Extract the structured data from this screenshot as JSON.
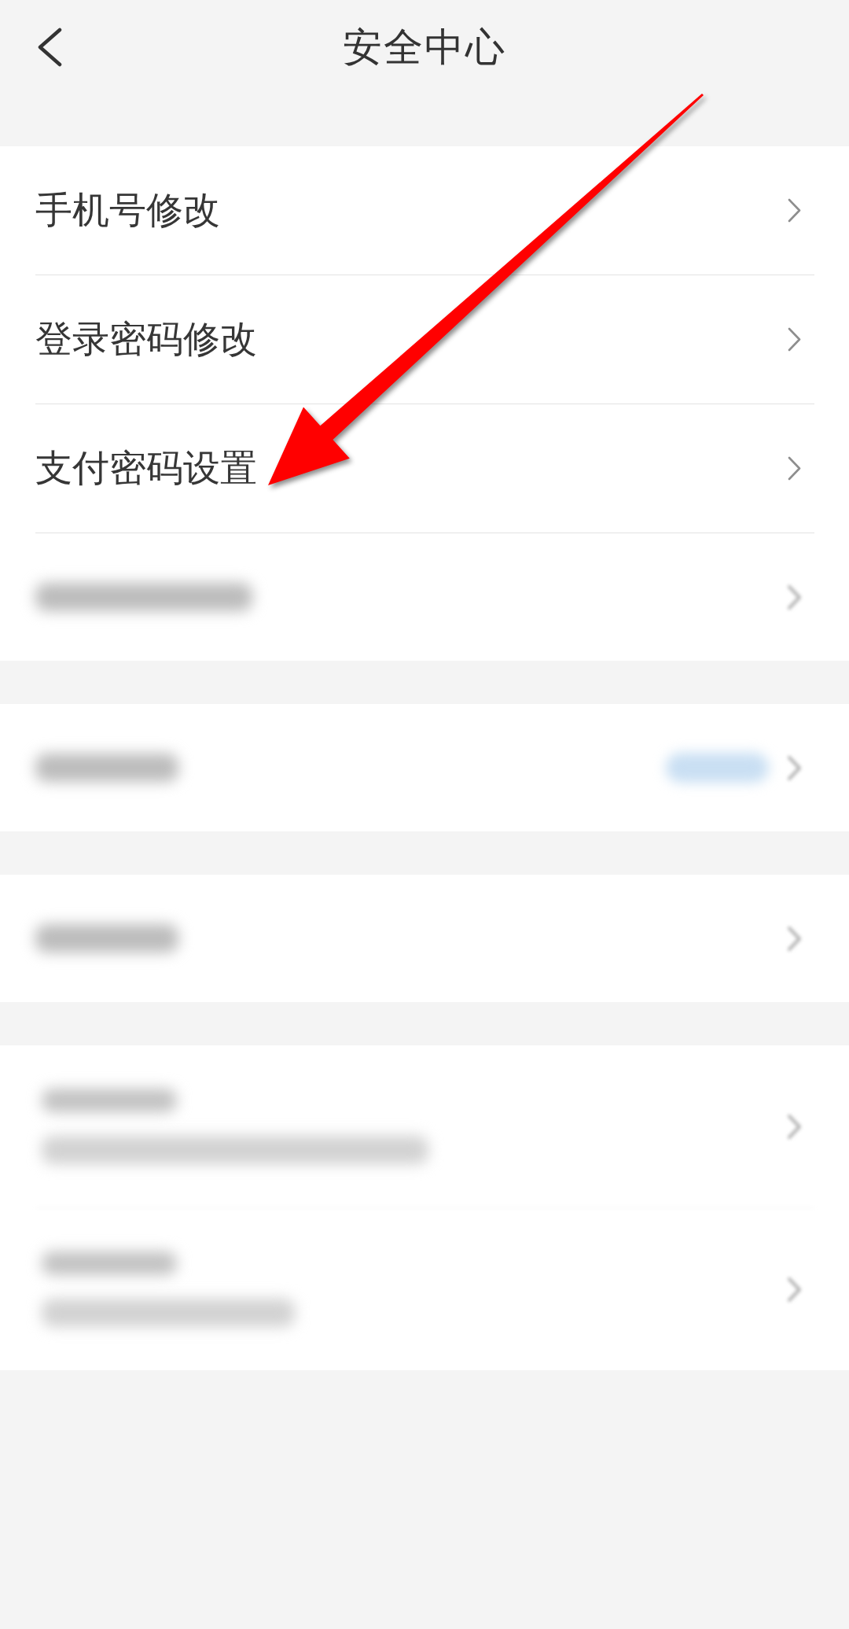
{
  "header": {
    "title": "安全中心"
  },
  "groups": [
    {
      "items": [
        {
          "kind": "nav",
          "label": "手机号修改"
        },
        {
          "kind": "nav",
          "label": "登录密码修改"
        },
        {
          "kind": "nav",
          "label": "支付密码设置"
        },
        {
          "kind": "blurred"
        }
      ]
    },
    {
      "items": [
        {
          "kind": "blurred_badge"
        }
      ]
    },
    {
      "items": [
        {
          "kind": "blurred"
        }
      ]
    },
    {
      "items": [
        {
          "kind": "blurred_double"
        },
        {
          "kind": "blurred_double"
        }
      ]
    }
  ],
  "annotation": {
    "kind": "arrow"
  }
}
